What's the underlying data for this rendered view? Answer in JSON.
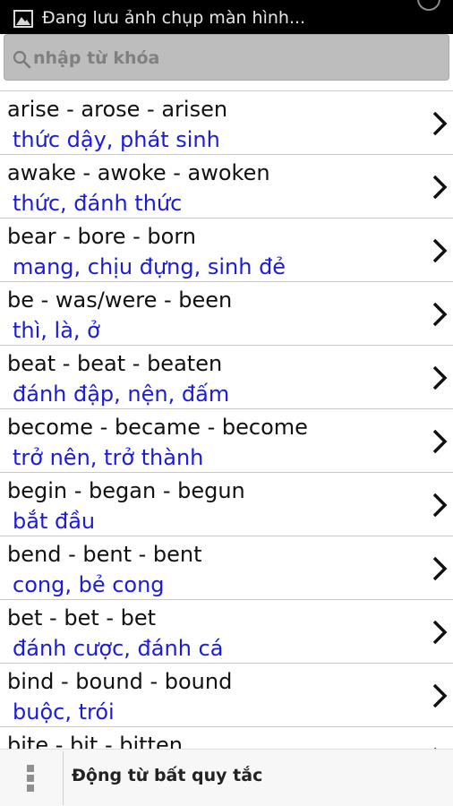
{
  "status_bar": {
    "notification_icon": "image-icon",
    "text": "Đang lưu ảnh chụp màn hình..."
  },
  "search": {
    "icon": "search-icon",
    "placeholder": "nhập từ khóa",
    "value": ""
  },
  "verbs": [
    {
      "forms": "arise - arose - arisen",
      "meaning": "thức dậy, phát sinh"
    },
    {
      "forms": "awake - awoke - awoken",
      "meaning": "thức, đánh thức"
    },
    {
      "forms": "bear - bore - born",
      "meaning": "mang, chịu đựng, sinh đẻ"
    },
    {
      "forms": "be - was/were - been",
      "meaning": "thì, là, ở"
    },
    {
      "forms": "beat - beat - beaten",
      "meaning": "đánh đập, nện, đấm"
    },
    {
      "forms": "become - became - become",
      "meaning": "trở nên, trở thành"
    },
    {
      "forms": "begin - began - begun",
      "meaning": "bắt đầu"
    },
    {
      "forms": "bend - bent - bent",
      "meaning": "cong, bẻ cong"
    },
    {
      "forms": "bet - bet - bet",
      "meaning": "đánh cược, đánh cá"
    },
    {
      "forms": "bind - bound - bound",
      "meaning": "buộc, trói"
    },
    {
      "forms": "bite - bit - bitten",
      "meaning": ""
    }
  ],
  "bottom_bar": {
    "menu_icon": "overflow-menu-icon",
    "title": "Động từ bất quy tắc"
  },
  "colors": {
    "meaning_text": "#1c1cd8",
    "status_bar_bg": "#000000",
    "search_box_bg": "#bdbdbd"
  }
}
